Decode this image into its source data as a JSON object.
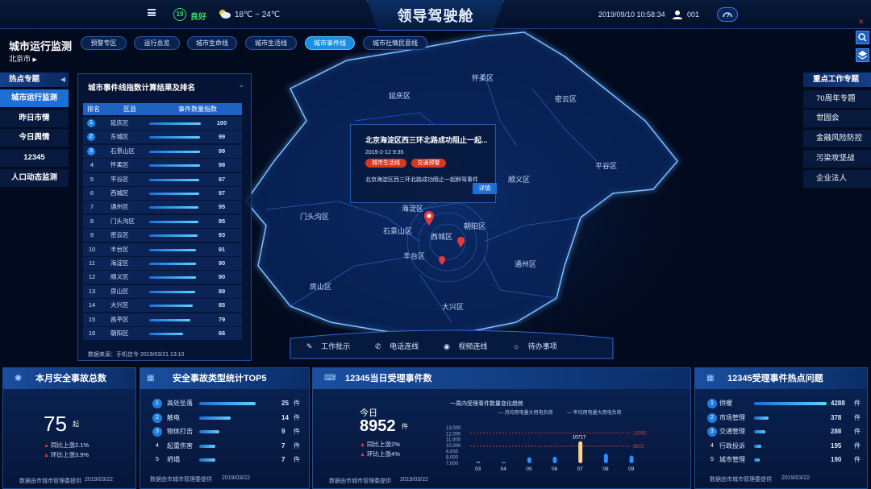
{
  "header": {
    "aqi_value": "19",
    "aqi_label": "良好",
    "temperature": "18℃ ~ 24℃",
    "title": "领导驾驶舱",
    "datetime": "2019/09/10 10:58:34",
    "user_id": "001"
  },
  "left_header": {
    "title": "城市运行监测",
    "city": "北京市"
  },
  "tabs": [
    {
      "label": "预警专区"
    },
    {
      "label": "运行总览"
    },
    {
      "label": "城市生命线"
    },
    {
      "label": "城市生活线"
    },
    {
      "label": "城市事件线"
    },
    {
      "label": "城市社情民意线"
    }
  ],
  "left_menu": {
    "title": "热点专题",
    "items": [
      "城市运行监测",
      "昨日市情",
      "今日舆情",
      "12345",
      "人口动态监测"
    ]
  },
  "right_menu": {
    "title": "重点工作专题",
    "items": [
      "70周年专题",
      "世园会",
      "金融风险防控",
      "污染攻坚战",
      "企业法人"
    ]
  },
  "ranking": {
    "title": "城市事件线指数计算结果及排名",
    "headers": [
      "排名",
      "区县",
      "事件数量指数"
    ],
    "rows": [
      {
        "rank": "1",
        "district": "延庆区",
        "value": "100",
        "pct": 100
      },
      {
        "rank": "2",
        "district": "东城区",
        "value": "99",
        "pct": 99
      },
      {
        "rank": "3",
        "district": "石景山区",
        "value": "99",
        "pct": 99
      },
      {
        "rank": "4",
        "district": "怀柔区",
        "value": "98",
        "pct": 98
      },
      {
        "rank": "5",
        "district": "平谷区",
        "value": "97",
        "pct": 97
      },
      {
        "rank": "6",
        "district": "西城区",
        "value": "97",
        "pct": 97
      },
      {
        "rank": "7",
        "district": "通州区",
        "value": "95",
        "pct": 95
      },
      {
        "rank": "8",
        "district": "门头沟区",
        "value": "95",
        "pct": 95
      },
      {
        "rank": "9",
        "district": "密云区",
        "value": "93",
        "pct": 93
      },
      {
        "rank": "10",
        "district": "丰台区",
        "value": "91",
        "pct": 91
      },
      {
        "rank": "11",
        "district": "海淀区",
        "value": "90",
        "pct": 90
      },
      {
        "rank": "12",
        "district": "顺义区",
        "value": "90",
        "pct": 90
      },
      {
        "rank": "13",
        "district": "房山区",
        "value": "89",
        "pct": 89
      },
      {
        "rank": "14",
        "district": "大兴区",
        "value": "85",
        "pct": 85
      },
      {
        "rank": "15",
        "district": "昌平区",
        "value": "79",
        "pct": 79
      },
      {
        "rank": "16",
        "district": "朝阳区",
        "value": "66",
        "pct": 66
      }
    ],
    "source": "数据来源：手机信令 2019/03/21 13:10"
  },
  "map_labels": [
    "延庆区",
    "怀柔区",
    "密云区",
    "平谷区",
    "门头沟区",
    "海淀区",
    "石景山区",
    "朝阳区",
    "西城区",
    "丰台区",
    "通州区",
    "房山区",
    "大兴区",
    "顺义区"
  ],
  "popup": {
    "title": "北京海淀区西三环北路成功阻止一起...",
    "date": "2019-2-12 9:35",
    "tag1": "城市生活线",
    "tag2": "交通预警",
    "desc": "北京海淀区西三环北路成功阻止一起醉驾事件",
    "detail": "详情"
  },
  "actions": [
    "工作批示",
    "电话连线",
    "视频连线",
    "待办事项"
  ],
  "panel1": {
    "title": "本月安全事故总数",
    "value": "75",
    "unit": "起",
    "up1": "同比上涨2.1%",
    "up2": "环比上涨3.9%",
    "source": "数据由市城市管理委提供",
    "date": "2019/03/22"
  },
  "panel2": {
    "title": "安全事故类型统计TOP5",
    "rows": [
      {
        "rank": "1",
        "label": "高处坠落",
        "value": "25",
        "unit": "件",
        "pct": 1.0
      },
      {
        "rank": "2",
        "label": "触电",
        "value": "14",
        "unit": "件",
        "pct": 0.56
      },
      {
        "rank": "3",
        "label": "物体打击",
        "value": "9",
        "unit": "件",
        "pct": 0.36
      },
      {
        "rank": "4",
        "label": "起重伤害",
        "value": "7",
        "unit": "件",
        "pct": 0.28
      },
      {
        "rank": "5",
        "label": "坍塌",
        "value": "7",
        "unit": "件",
        "pct": 0.28
      }
    ],
    "source": "数据由市城市管理委提供",
    "date": "2019/03/22"
  },
  "panel3": {
    "title": "12345当日受理事件数",
    "today_label": "今日",
    "value": "8952",
    "unit": "件",
    "up1": "同比上涨2%",
    "up2": "环比上涨4%",
    "source": "数据由市城市管理委提供",
    "date": "2019/03/22"
  },
  "chart_data": {
    "type": "bar",
    "title": "一周内受理事件数量变化趋势",
    "legend": [
      "月均用电量大用电负荷",
      "年均用电量大用电负荷"
    ],
    "categories": [
      "03",
      "04",
      "05",
      "06",
      "07",
      "08",
      "09"
    ],
    "values": [
      7300,
      7200,
      8000,
      8100,
      10717,
      8600,
      8300
    ],
    "highlight_index": 4,
    "highlight_label": "10717",
    "reference_lines": [
      {
        "value": 12092,
        "label": "12092",
        "color": "#e0453a"
      },
      {
        "value": 9872,
        "label": "9872",
        "color": "#e0453a"
      }
    ],
    "y_ticks": [
      "13,000",
      "12,000",
      "11,000",
      "10,000",
      "9,000",
      "8,000",
      "7,000"
    ],
    "ylim": [
      7000,
      13000
    ]
  },
  "panel4": {
    "title": "12345受理事件热点问题",
    "rows": [
      {
        "rank": "1",
        "label": "供暖",
        "value": "4288",
        "unit": "件",
        "pct": 1.0
      },
      {
        "rank": "2",
        "label": "市场管理",
        "value": "378",
        "unit": "件",
        "pct": 0.2
      },
      {
        "rank": "3",
        "label": "交通管理",
        "value": "288",
        "unit": "件",
        "pct": 0.16
      },
      {
        "rank": "4",
        "label": "行政投诉",
        "value": "195",
        "unit": "件",
        "pct": 0.1
      },
      {
        "rank": "5",
        "label": "城市管理",
        "value": "190",
        "unit": "件",
        "pct": 0.08
      }
    ],
    "source": "数据由市城市管理委提供",
    "date": "2019/03/22"
  }
}
